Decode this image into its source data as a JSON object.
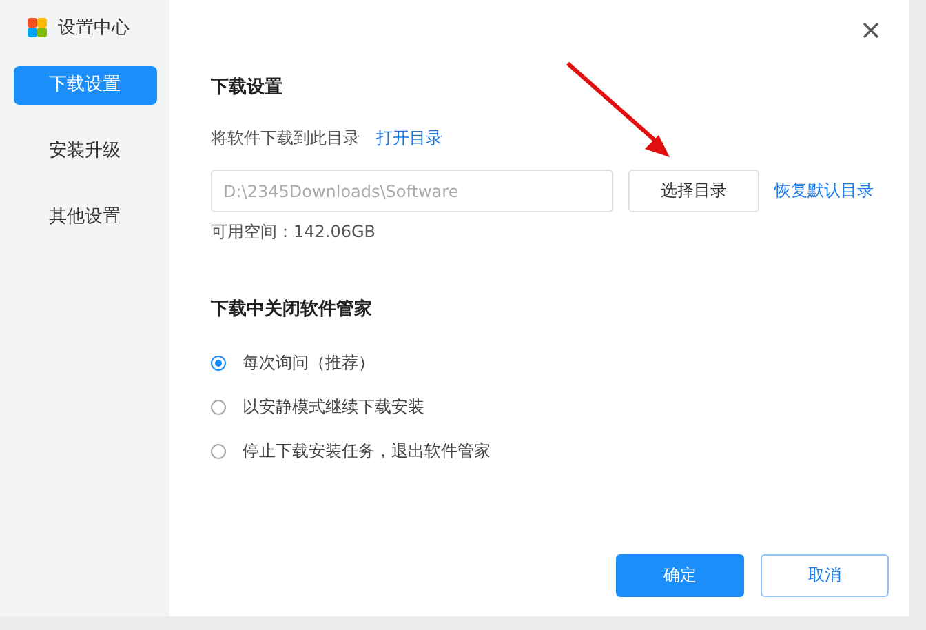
{
  "window": {
    "title": "设置中心"
  },
  "sidebar": {
    "items": [
      {
        "label": "下载设置",
        "selected": true
      },
      {
        "label": "安装升级",
        "selected": false
      },
      {
        "label": "其他设置",
        "selected": false
      }
    ]
  },
  "download": {
    "heading": "下载设置",
    "label": "将软件下载到此目录",
    "open_link": "打开目录",
    "placeholder": "D:\\2345Downloads\\Software",
    "choose_button": "选择目录",
    "reset_link": "恢复默认目录",
    "free_space": "可用空间：142.06GB"
  },
  "close_option": {
    "heading": "下载中关闭软件管家",
    "options": [
      {
        "label": "每次询问（推荐）",
        "selected": true
      },
      {
        "label": "以安静模式继续下载安装",
        "selected": false
      },
      {
        "label": "停止下载安装任务，退出软件管家",
        "selected": false
      }
    ]
  },
  "buttons": {
    "ok": "确定",
    "cancel": "取消"
  }
}
